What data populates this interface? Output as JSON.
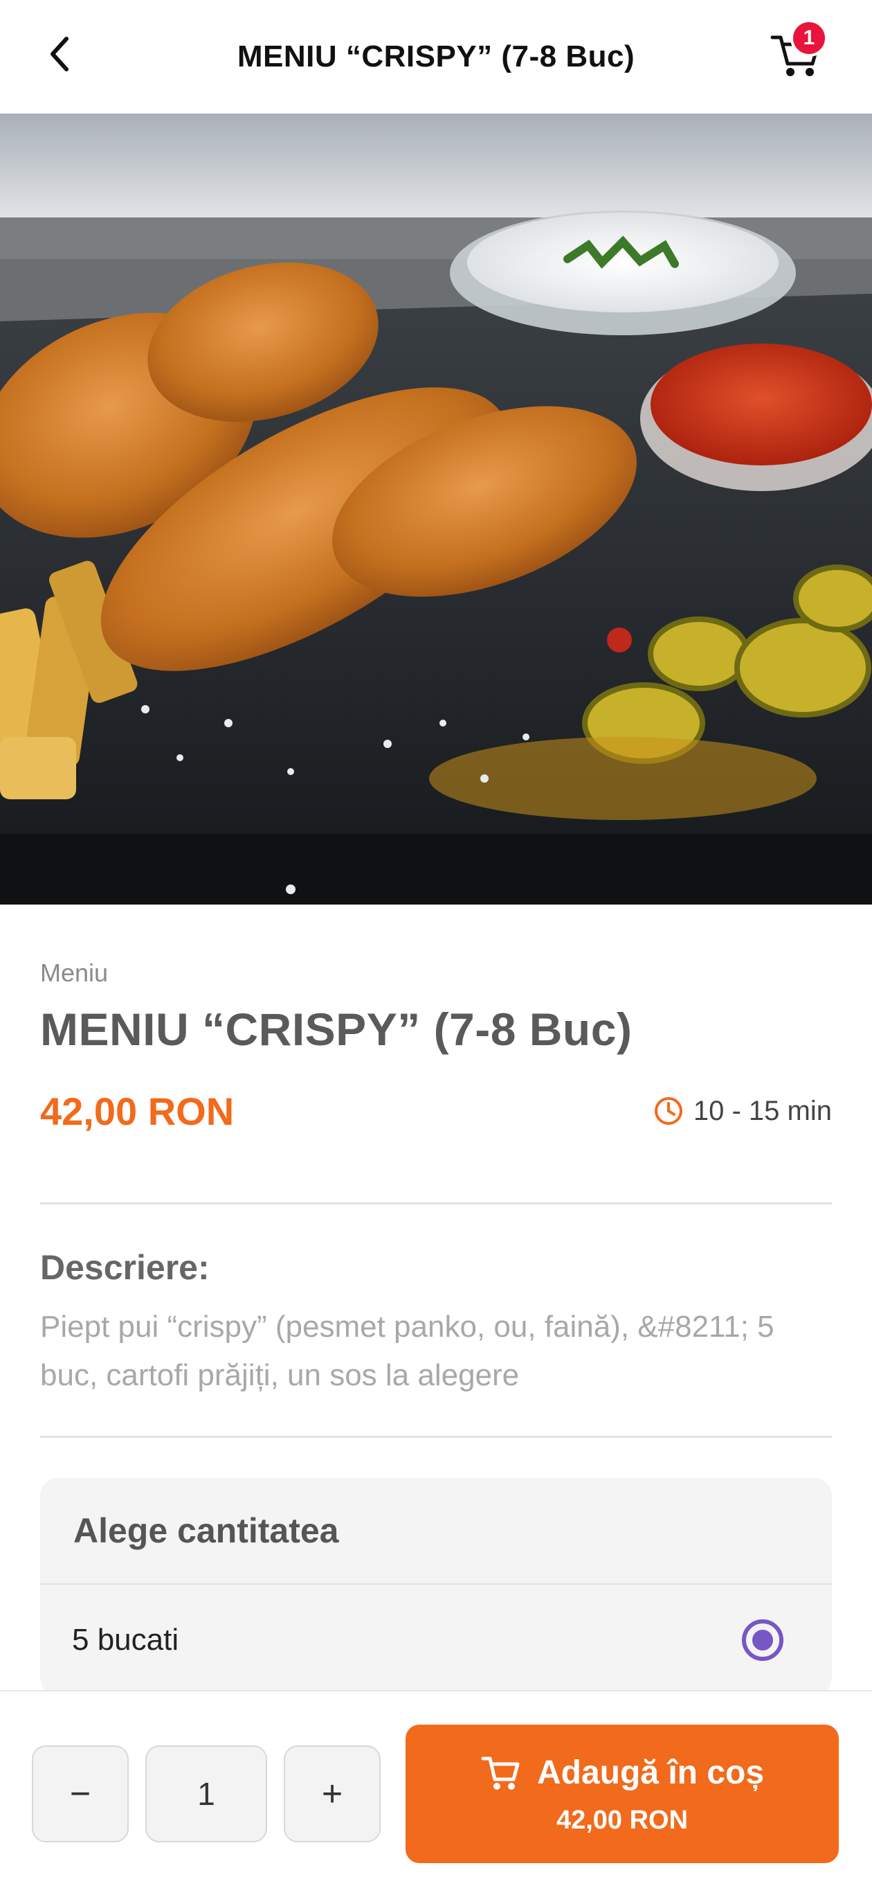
{
  "header": {
    "title": "MENIU “CRISPY” (7-8 Buc)",
    "cart_count": "1"
  },
  "product": {
    "category": "Meniu",
    "title": "MENIU “CRISPY” (7-8 Buc)",
    "price": "42,00 RON",
    "prep_time": "10 - 15 min",
    "description_heading": "Descriere:",
    "description": "Piept pui  “crispy” (pesmet panko, ou, faină), &#8211; 5 buc, cartofi prăjiți, un sos la alegere"
  },
  "options": {
    "heading": "Alege cantitatea",
    "items": [
      {
        "label": "5 bucati",
        "selected": true
      }
    ]
  },
  "bottom_bar": {
    "minus_label": "−",
    "quantity": "1",
    "plus_label": "+",
    "add_label": "Adaugă în coș",
    "add_price": "42,00 RON"
  },
  "colors": {
    "accent": "#f26a1b",
    "badge": "#e8143c",
    "radio": "#7657c4"
  }
}
